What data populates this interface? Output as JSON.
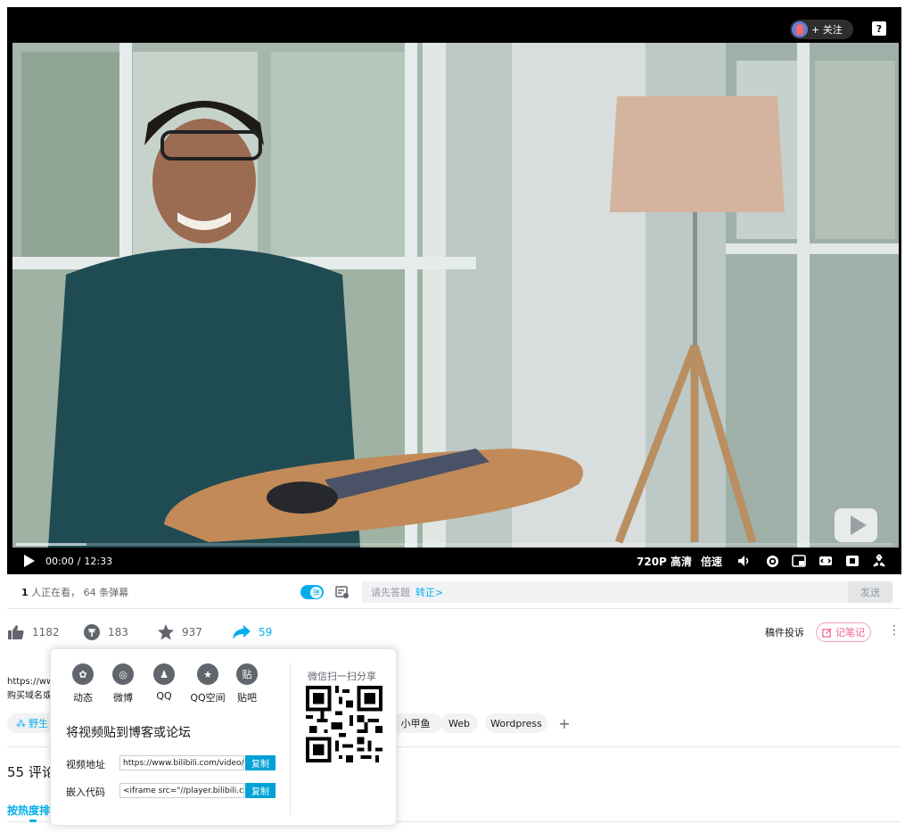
{
  "player": {
    "follow_label": "+ 关注",
    "help_label": "?",
    "time_current": "00:00",
    "time_separator": "/",
    "time_total": "12:33",
    "quality": "720P 高清",
    "speed": "倍速",
    "progress": 0.08
  },
  "danmaku_bar": {
    "viewers_count": "1",
    "viewers_text": " 人正在看，",
    "danmaku_count": " 64 条弹幕",
    "toggle_label": "弹",
    "input_placeholder": "请先答题",
    "input_link": "转正>",
    "send_label": "发送"
  },
  "toolbar": {
    "likes": "1182",
    "coins": "183",
    "favorites": "937",
    "shares": "59",
    "report_label": "稿件投诉",
    "note_label": "记笔记",
    "more_label": "⋮"
  },
  "description": {
    "line1": "https://www",
    "line2": "购买域名或"
  },
  "tags": {
    "first": "野生",
    "items": [
      "小甲鱼",
      "Web",
      "Wordpress"
    ],
    "plus": "+"
  },
  "comments": {
    "title": "55  评论",
    "sort_label": "按热度排"
  },
  "share_popup": {
    "items": [
      {
        "label": "动态",
        "glyph": "✿"
      },
      {
        "label": "微博",
        "glyph": "◎"
      },
      {
        "label": "QQ",
        "glyph": "♟"
      },
      {
        "label": "QQ空间",
        "glyph": "★"
      },
      {
        "label": "贴吧",
        "glyph": "贴"
      }
    ],
    "title": "将视频贴到博客或论坛",
    "url_label": "视频地址",
    "url_value": "https://www.bilibili.com/video/B",
    "embed_label": "嵌入代码",
    "embed_value": "<iframe src=\"//player.bilibili.co",
    "copy_label": "复制",
    "qr_title": "微信扫一扫分享"
  }
}
